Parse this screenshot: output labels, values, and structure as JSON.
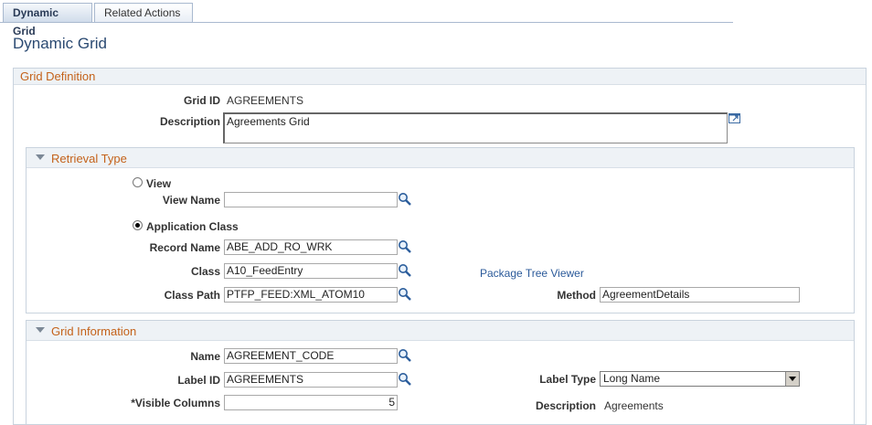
{
  "tabs": [
    {
      "label": "Dynamic Grid",
      "active": true
    },
    {
      "label": "Related Actions",
      "active": false
    }
  ],
  "page_title": "Dynamic Grid",
  "grid_definition": {
    "title": "Grid Definition",
    "grid_id_label": "Grid ID",
    "grid_id_value": "AGREEMENTS",
    "description_label": "Description",
    "description_value": "Agreements Grid"
  },
  "retrieval_type": {
    "title": "Retrieval Type",
    "view_option_label": "View",
    "view_name_label": "View Name",
    "view_name_value": "",
    "app_class_option_label": "Application Class",
    "selected": "Application Class",
    "record_name_label": "Record Name",
    "record_name_value": "ABE_ADD_RO_WRK",
    "class_label": "Class",
    "class_value": "A10_FeedEntry",
    "package_tree_viewer_link": "Package Tree Viewer",
    "class_path_label": "Class Path",
    "class_path_value": "PTFP_FEED:XML_ATOM10",
    "method_label": "Method",
    "method_value": "AgreementDetails"
  },
  "grid_information": {
    "title": "Grid Information",
    "name_label": "Name",
    "name_value": "AGREEMENT_CODE",
    "label_id_label": "Label ID",
    "label_id_value": "AGREEMENTS",
    "label_type_label": "Label Type",
    "label_type_value": "Long Name",
    "visible_columns_label": "*Visible Columns",
    "visible_columns_value": "5",
    "description_label": "Description",
    "description_value": "Agreements"
  },
  "icons": {
    "lookup": "magnifier-lookup-icon",
    "expand": "expand-text-icon",
    "collapse": "collapse-triangle-icon"
  }
}
